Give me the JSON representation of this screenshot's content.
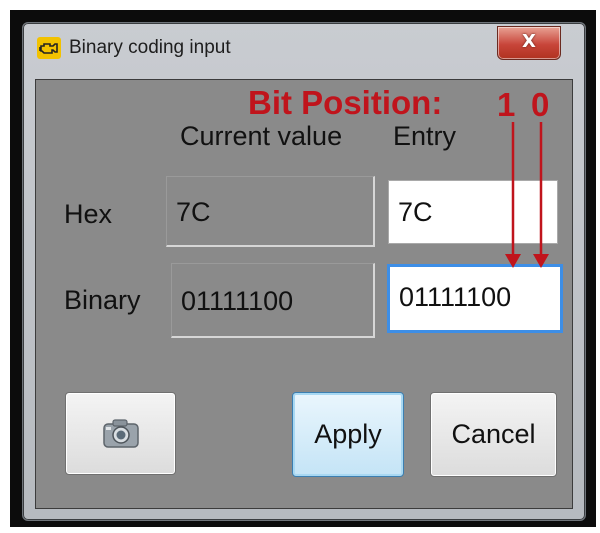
{
  "window": {
    "title": "Binary coding input",
    "close_label": "X"
  },
  "annotation": {
    "text": "Bit Position:",
    "bit1": "1",
    "bit0": "0",
    "color": "#c0141c"
  },
  "columns": {
    "current": "Current value",
    "entry": "Entry"
  },
  "rows": {
    "hex": {
      "label": "Hex",
      "current": "7C",
      "entry": "7C"
    },
    "binary": {
      "label": "Binary",
      "current": "01111100",
      "entry": "01111100"
    }
  },
  "buttons": {
    "apply": "Apply",
    "cancel": "Cancel",
    "snapshot_icon": "camera-icon"
  },
  "colors": {
    "client_bg": "#8a8a8a",
    "focus_border": "#3d8ee6",
    "title_icon_bg": "#f2c200"
  }
}
